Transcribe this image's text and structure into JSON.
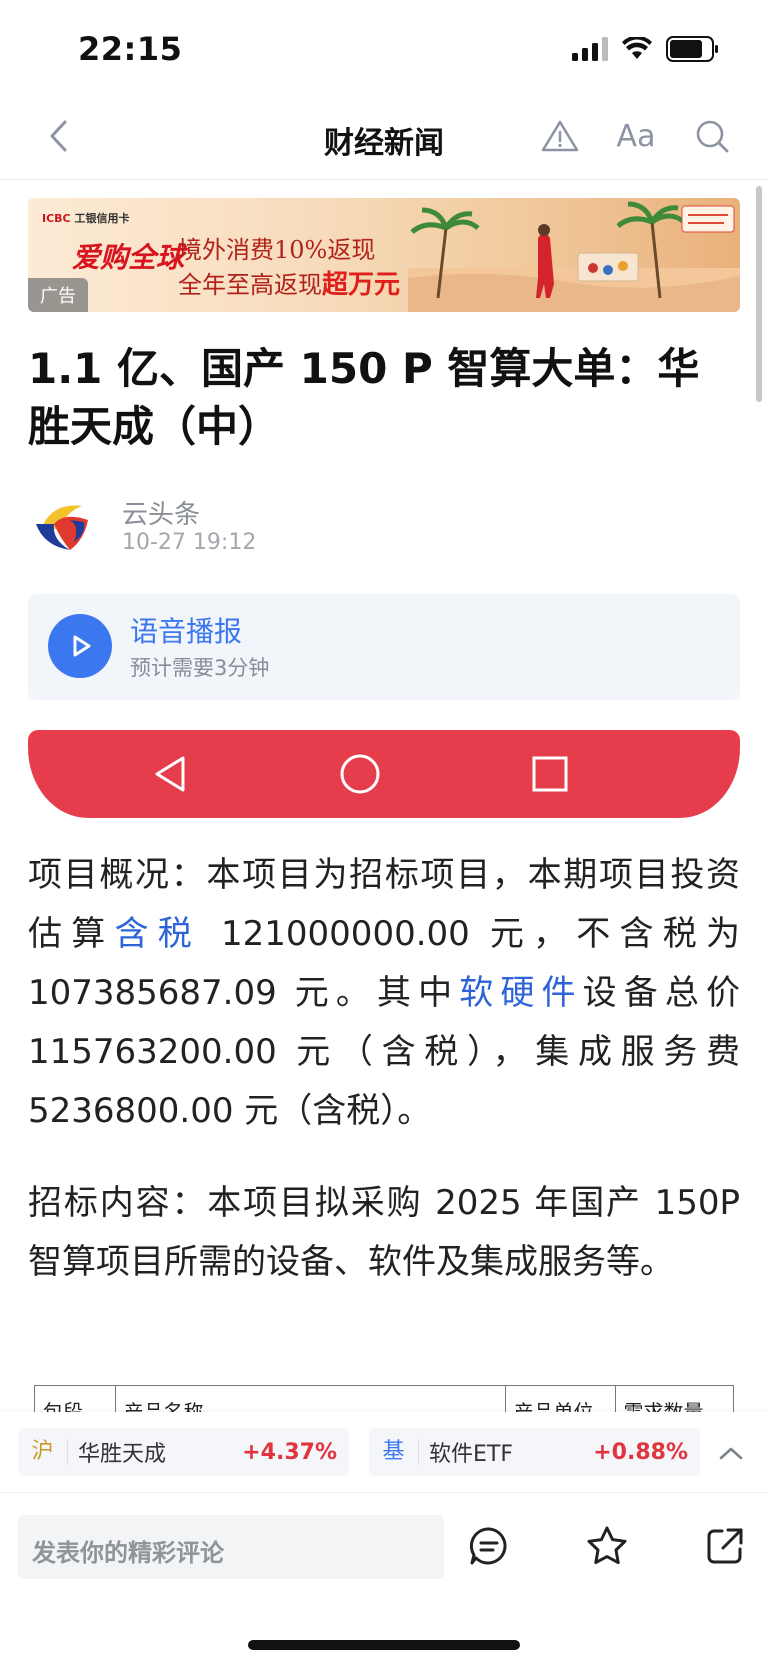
{
  "status": {
    "time": "22:15"
  },
  "nav": {
    "title": "财经新闻",
    "font_label": "Aa"
  },
  "ad": {
    "bank": "ICBC",
    "bank_cn": "工银信用卡",
    "brand": "爱购全球",
    "line1": "境外消费10%返现",
    "line2_prefix": "全年至高返现",
    "line2_highlight": "超万元",
    "tag": "广告"
  },
  "article": {
    "headline": "1.1 亿、国产 150 P 智算大单：华胜天成（中）",
    "author": "云头条",
    "time": "10-27 19:12"
  },
  "audio": {
    "title": "语音播报",
    "subtitle": "预计需要3分钟"
  },
  "body": {
    "p1": {
      "a": "项目概况：本项目为招标项目，本期项目投资估算",
      "kw1": "含税",
      "b": " 121000000.00 元，不含税为 107385687.09 元。其中",
      "kw2": "软硬件",
      "c": "设备总价 115763200.00 元（含税），集成服务费 5236800.00 元（含税）。"
    },
    "p2": "招标内容：本项目拟采购 2025 年国产 150P 智算项目所需的设备、软件及集成服务等。"
  },
  "table": {
    "headers": [
      "包段",
      "产品名称",
      "产品单位",
      "需求数量"
    ]
  },
  "stocks": [
    {
      "market": "沪",
      "name": "华胜天成",
      "change": "+4.37%"
    },
    {
      "market": "基",
      "name": "软件ETF",
      "change": "+0.88%"
    }
  ],
  "comment": {
    "placeholder": "发表你的精彩评论"
  },
  "colors": {
    "accent": "#3b78f0",
    "red": "#e63d4c",
    "rise": "#e0343e"
  }
}
